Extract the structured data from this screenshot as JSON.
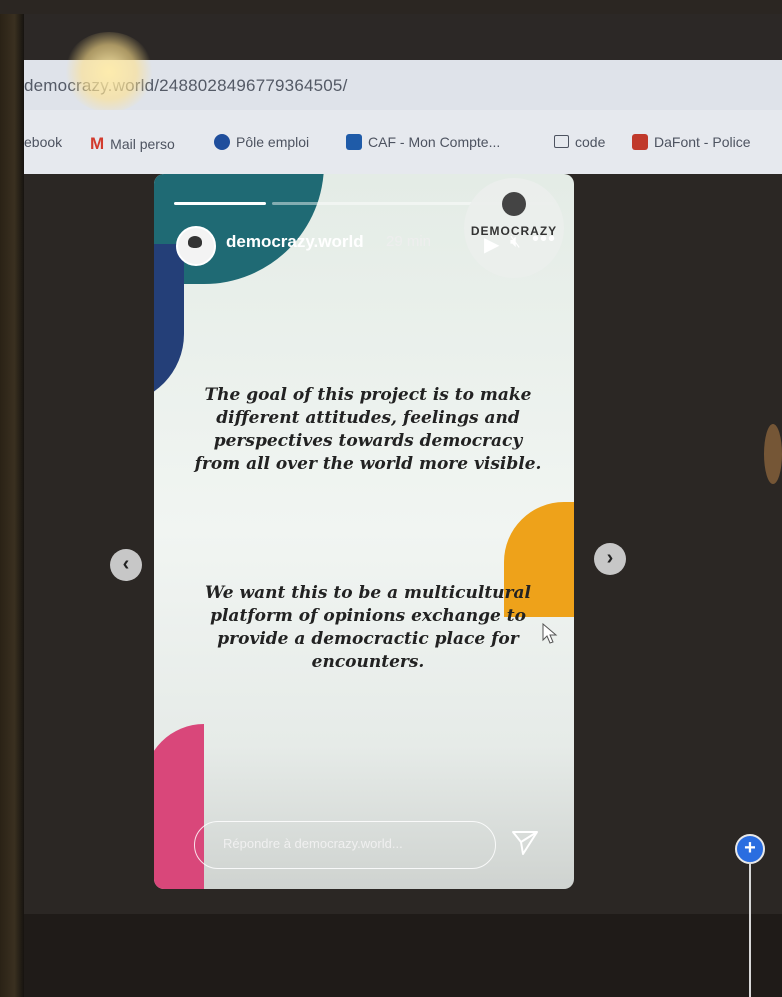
{
  "browser": {
    "url": "democrazy.world/2488028496779364505/",
    "bookmarks": [
      {
        "label": "ebook",
        "icon": "facebook-icon",
        "color": "#3b5998"
      },
      {
        "label": "Mail perso",
        "icon": "gmail-icon",
        "color": "#d23b2d"
      },
      {
        "label": "Pôle emploi",
        "icon": "pole-emploi-icon",
        "color": "#1f4e9c"
      },
      {
        "label": "CAF - Mon Compte...",
        "icon": "caf-icon",
        "color": "#1f5ba8"
      },
      {
        "label": "code",
        "icon": "folder-icon",
        "color": "#4d5360"
      },
      {
        "label": "DaFont - Police",
        "icon": "dafont-icon",
        "color": "#c0392b"
      }
    ]
  },
  "story": {
    "username": "democrazy.world",
    "time": "29 min",
    "logo_text": "DEMOCRAZY",
    "paragraph1": "The goal of this project is to make different attitudes, feelings and perspectives towards democracy from all over the world more visible.",
    "paragraph2": "We want this to be a multicultural platform of opinions exchange to provide a democractic place for encounters.",
    "reply_placeholder": "Répondre à democrazy.world...",
    "progress": [
      1.0,
      0.0
    ],
    "colors": {
      "teal": "#1f6a74",
      "navy": "#243f78",
      "orange": "#eea21a",
      "pink": "#d9477a"
    }
  },
  "icons": {
    "play": "play-icon",
    "mute": "speaker-muted-icon",
    "more": "more-icon",
    "send": "send-icon",
    "prev": "chevron-left-icon",
    "next": "chevron-right-icon",
    "add": "plus-icon"
  }
}
